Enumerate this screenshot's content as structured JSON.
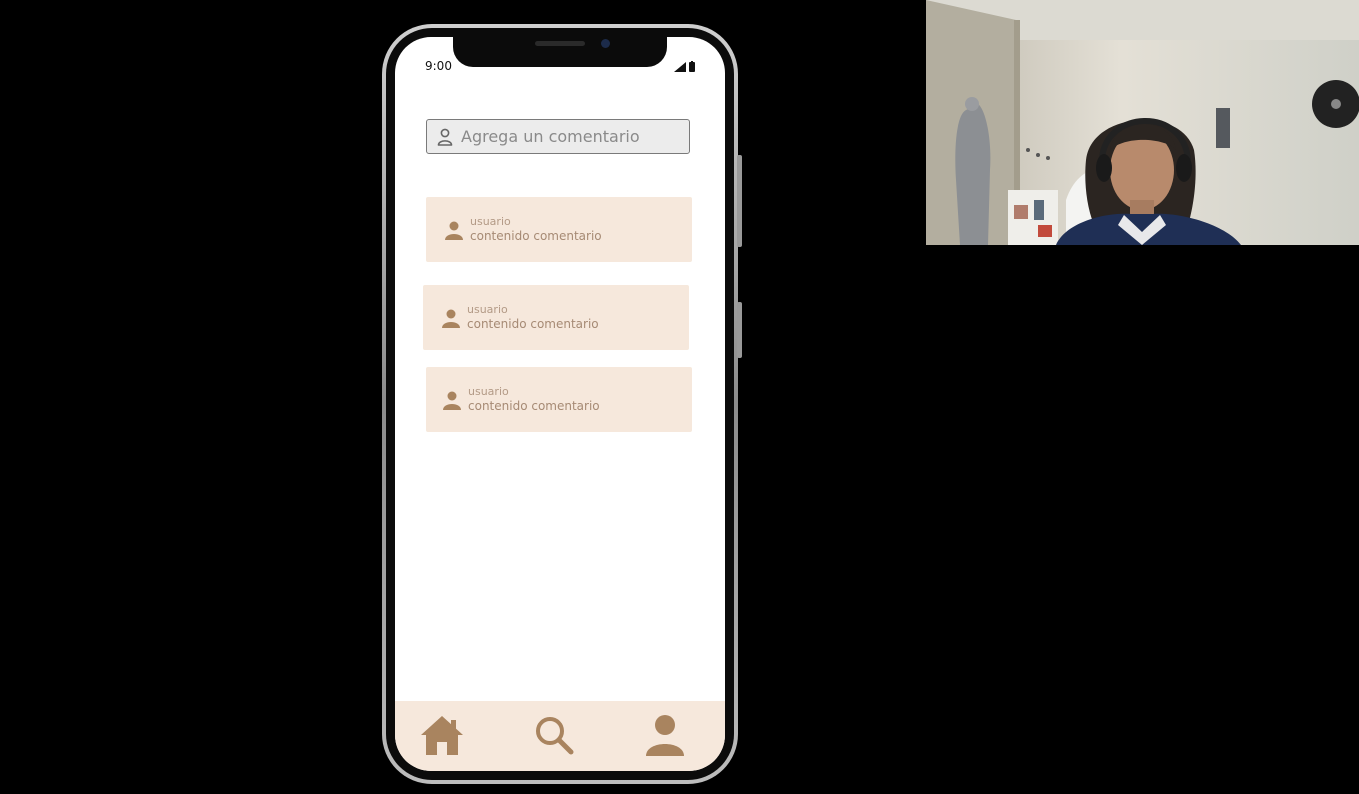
{
  "phone": {
    "status_time": "9:00",
    "comment_input": {
      "placeholder": "Agrega un comentario"
    },
    "comments": [
      {
        "user": "usuario",
        "content": "contenido comentario"
      },
      {
        "user": "usuario",
        "content": "contenido comentario"
      },
      {
        "user": "usuario",
        "content": "contenido comentario"
      }
    ],
    "nav": [
      "home-icon",
      "search-icon",
      "profile-icon"
    ]
  },
  "colors": {
    "background": "#000000",
    "card": "#f6e8dc",
    "accent": "#a9845f"
  }
}
